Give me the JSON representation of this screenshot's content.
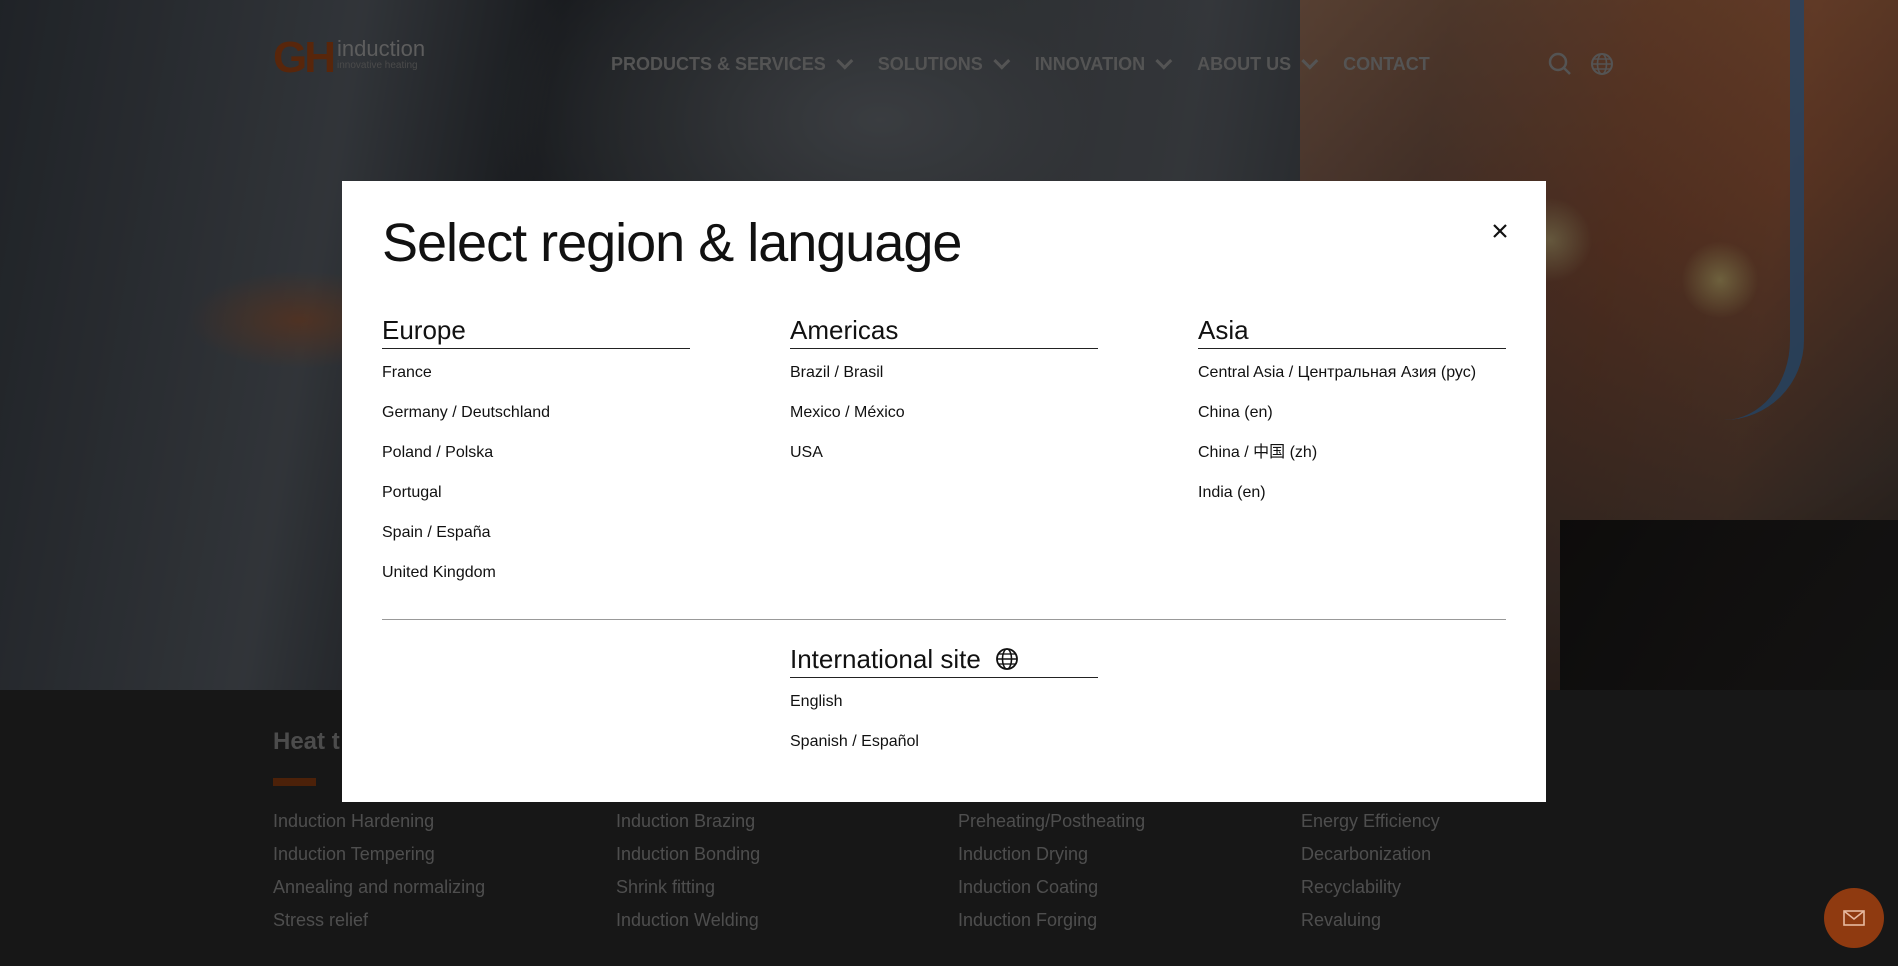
{
  "header": {
    "logo_mark": "GH",
    "logo_brand": "induction",
    "logo_tagline": "innovative heating",
    "nav": [
      {
        "label": "PRODUCTS & SERVICES",
        "has_menu": true
      },
      {
        "label": "SOLUTIONS",
        "has_menu": true
      },
      {
        "label": "INNOVATION",
        "has_menu": true
      },
      {
        "label": "ABOUT US",
        "has_menu": true
      },
      {
        "label": "CONTACT",
        "has_menu": false
      }
    ],
    "icons": [
      "search-icon",
      "globe-icon"
    ]
  },
  "lower": {
    "title": "Heat t",
    "columns": [
      [
        "Induction Hardening",
        "Induction Tempering",
        "Annealing and normalizing",
        "Stress relief"
      ],
      [
        "Induction Brazing",
        "Induction Bonding",
        "Shrink fitting",
        "Induction Welding"
      ],
      [
        "Preheating/Postheating",
        "Induction Drying",
        "Induction Coating",
        "Induction Forging"
      ],
      [
        "Energy Efficiency",
        "Decarbonization",
        "Recyclability",
        "Revaluing"
      ]
    ],
    "fab_icon": "mail-icon"
  },
  "modal": {
    "title": "Select region & language",
    "close_icon": "close-icon",
    "regions": [
      {
        "name": "Europe",
        "options": [
          "France",
          "Germany / Deutschland",
          "Poland / Polska",
          "Portugal",
          "Spain / España",
          "United Kingdom"
        ]
      },
      {
        "name": "Americas",
        "options": [
          "Brazil / Brasil",
          "Mexico / México",
          "USA"
        ]
      },
      {
        "name": "Asia",
        "options": [
          "Central Asia / Центральная Азия (рус)",
          "China (en)",
          "China / 中国 (zh)",
          "India (en)"
        ]
      }
    ],
    "international": {
      "title": "International site",
      "icon": "globe-icon",
      "options": [
        "English",
        "Spanish / Español"
      ]
    }
  },
  "colors": {
    "brand": "#a04515",
    "modal_bg": "#ffffff",
    "overlay": "rgba(0,0,0,0.45)"
  }
}
